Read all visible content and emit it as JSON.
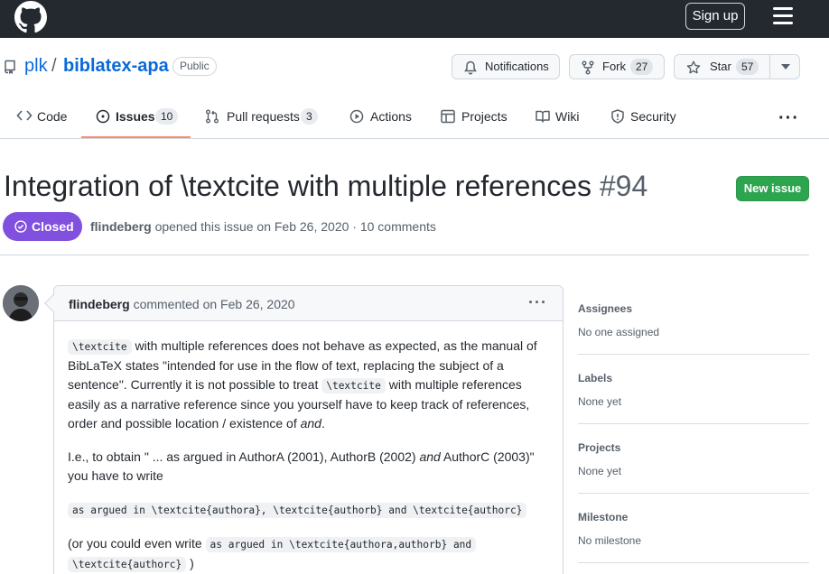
{
  "header": {
    "signup_label": "Sign up"
  },
  "repo": {
    "owner": "plk",
    "separator": "/",
    "name": "biblatex-apa",
    "visibility": "Public",
    "notifications_label": "Notifications",
    "fork_label": "Fork",
    "fork_count": "27",
    "star_label": "Star",
    "star_count": "57"
  },
  "tabs": [
    {
      "label": "Code",
      "icon": "code-icon"
    },
    {
      "label": "Issues",
      "icon": "issue-opened-icon",
      "count": "10",
      "active": true
    },
    {
      "label": "Pull requests",
      "icon": "git-pull-request-icon",
      "count": "3"
    },
    {
      "label": "Actions",
      "icon": "play-icon"
    },
    {
      "label": "Projects",
      "icon": "table-icon"
    },
    {
      "label": "Wiki",
      "icon": "book-icon"
    },
    {
      "label": "Security",
      "icon": "shield-icon"
    }
  ],
  "issue": {
    "title": "Integration of \\textcite with multiple references",
    "number": "#94",
    "new_issue_label": "New issue",
    "state": "Closed",
    "author": "flindeberg",
    "meta": "opened this issue on Feb 26, 2020 · 10 comments"
  },
  "comment": {
    "author": "flindeberg",
    "action": "commented on Feb 26, 2020",
    "p1_code1": "\\textcite",
    "p1_text1": " with multiple references does not behave as expected, as the manual of BibLaTeX states \"intended for use in the flow of text, replacing the subject of a sentence\". Currently it is not possible to treat ",
    "p1_code2": "\\textcite",
    "p1_text2": " with multiple references easily as a narrative reference since you yourself have to keep track of references, order and possible location / existence of ",
    "p1_em": "and",
    "p1_end": ".",
    "p2_text1": "I.e., to obtain \" ... as argued in AuthorA (2001), AuthorB (2002) ",
    "p2_em": "and",
    "p2_text2": " AuthorC (2003)\" you have to write",
    "code_line": "as argued in \\textcite{authora}, \\textcite{authorb} and \\textcite{authorc}",
    "p3_text1": "(or you could even write ",
    "p3_code1": "as argued in \\textcite{authora,authorb} and",
    "p3_code2": "\\textcite{authorc}",
    "p3_text2": " )"
  },
  "sidebar": [
    {
      "heading": "Assignees",
      "value": "No one assigned"
    },
    {
      "heading": "Labels",
      "value": "None yet"
    },
    {
      "heading": "Projects",
      "value": "None yet"
    },
    {
      "heading": "Milestone",
      "value": "No milestone"
    }
  ],
  "colors": {
    "header_bg": "#24292f",
    "link": "#0969da",
    "closed": "#8250df",
    "new_issue": "#2da44e",
    "active_tab": "#fd8c73"
  }
}
